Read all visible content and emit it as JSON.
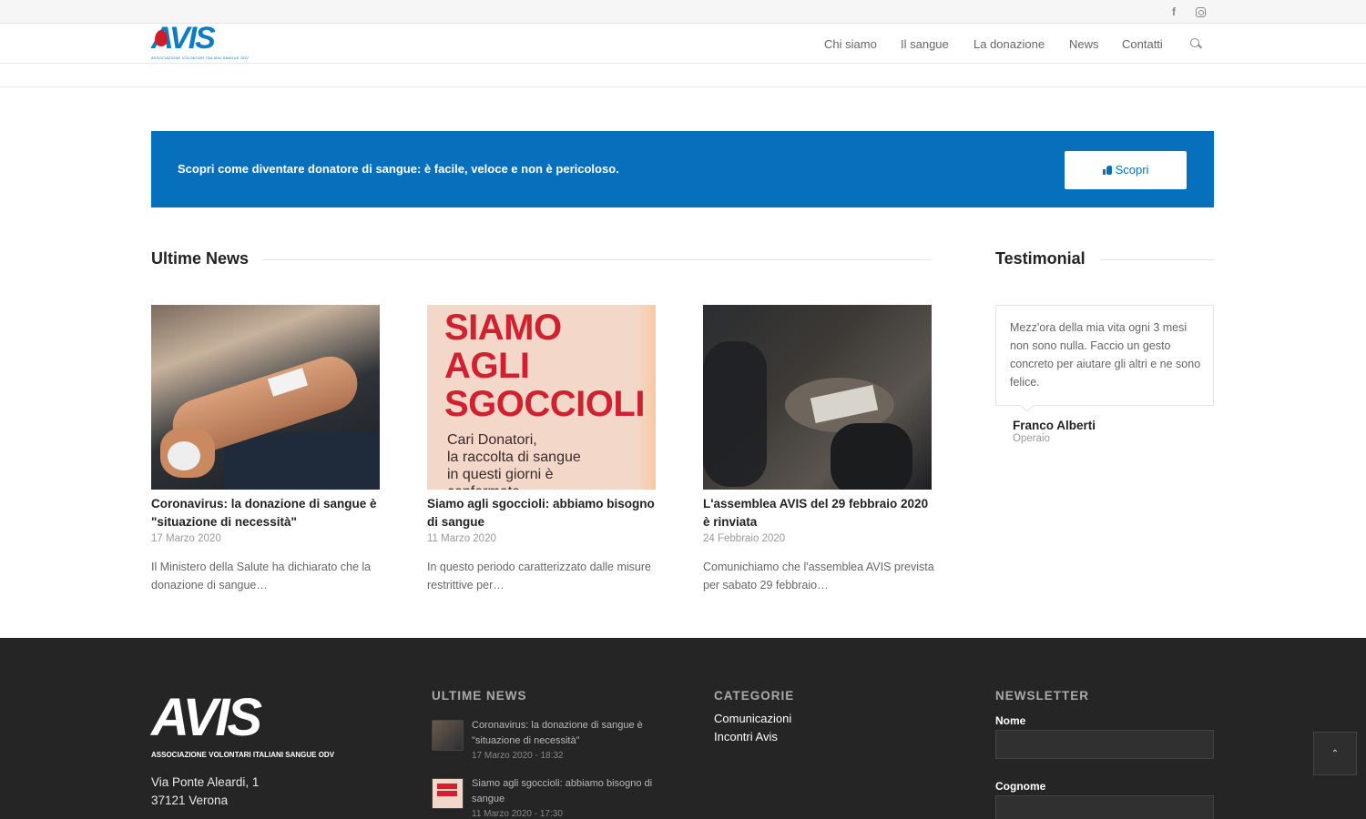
{
  "topbar": {
    "facebook_icon": "facebook-icon",
    "facebook_glyph": "f",
    "instagram_icon": "instagram-icon"
  },
  "header": {
    "logo_text": "AVIS",
    "logo_subtitle": "ASSOCIAZIONE VOLONTARI ITALIANI SANGUE ODV",
    "nav": [
      "Chi siamo",
      "Il sangue",
      "La donazione",
      "News",
      "Contatti"
    ],
    "search_icon": "search-icon"
  },
  "banner": {
    "text": "Scopri come diventare donatore di sangue: è facile, veloce e non è pericoloso.",
    "button_label": "Scopri",
    "button_icon": "thumbs-up-icon",
    "color": "#0770bd"
  },
  "news_section": {
    "title": "Ultime News",
    "items": [
      {
        "title": "Coronavirus: la donazione di sangue è \"situazione di necessità\"",
        "date": "17 Marzo 2020",
        "excerpt": "Il Ministero della Salute ha dichiarato che la donazione di sangue…"
      },
      {
        "title": "Siamo agli sgoccioli: abbiamo bisogno di sangue",
        "date": "11 Marzo 2020",
        "excerpt": "In questo periodo caratterizzato dalle misure restrittive per…",
        "image_text": {
          "headline": [
            "SIAMO",
            "AGLI",
            "SGOCCIOLI"
          ],
          "body": [
            "Cari Donatori,",
            "la raccolta di sangue",
            "in questi giorni è",
            "confermata"
          ]
        }
      },
      {
        "title": "L'assemblea AVIS del 29 febbraio 2020 è rinviata",
        "date": "24 Febbraio 2020",
        "excerpt": "Comunichiamo che l'assemblea AVIS prevista per sabato 29 febbraio…"
      }
    ]
  },
  "testimonial_section": {
    "title": "Testimonial",
    "quote": "Mezz'ora della mia vita ogni 3 mesi non sono nulla. Faccio un gesto concreto per aiutare gli altri e ne sono felice.",
    "name": "Franco Alberti",
    "role": "Operaio"
  },
  "footer": {
    "logo_text": "AVIS",
    "logo_subtitle": "ASSOCIAZIONE VOLONTARI ITALIANI SANGUE ODV",
    "address_line1": "Via Ponte Aleardi, 1",
    "address_line2": "37121 Verona",
    "news_title": "ULTIME NEWS",
    "news": [
      {
        "title": "Coronavirus: la donazione di sangue è \"situazione di necessità\"",
        "date": "17 Marzo 2020 - 18:32"
      },
      {
        "title": "Siamo agli sgoccioli: abbiamo bisogno di sangue",
        "date": "11 Marzo 2020 - 17:30"
      }
    ],
    "categories_title": "CATEGORIE",
    "categories": [
      "Comunicazioni",
      "Incontri Avis"
    ],
    "newsletter_title": "NEWSLETTER",
    "name_label": "Nome",
    "surname_label": "Cognome",
    "scroll_top_icon": "chevron-up-icon",
    "scroll_top_glyph": "⌃"
  }
}
